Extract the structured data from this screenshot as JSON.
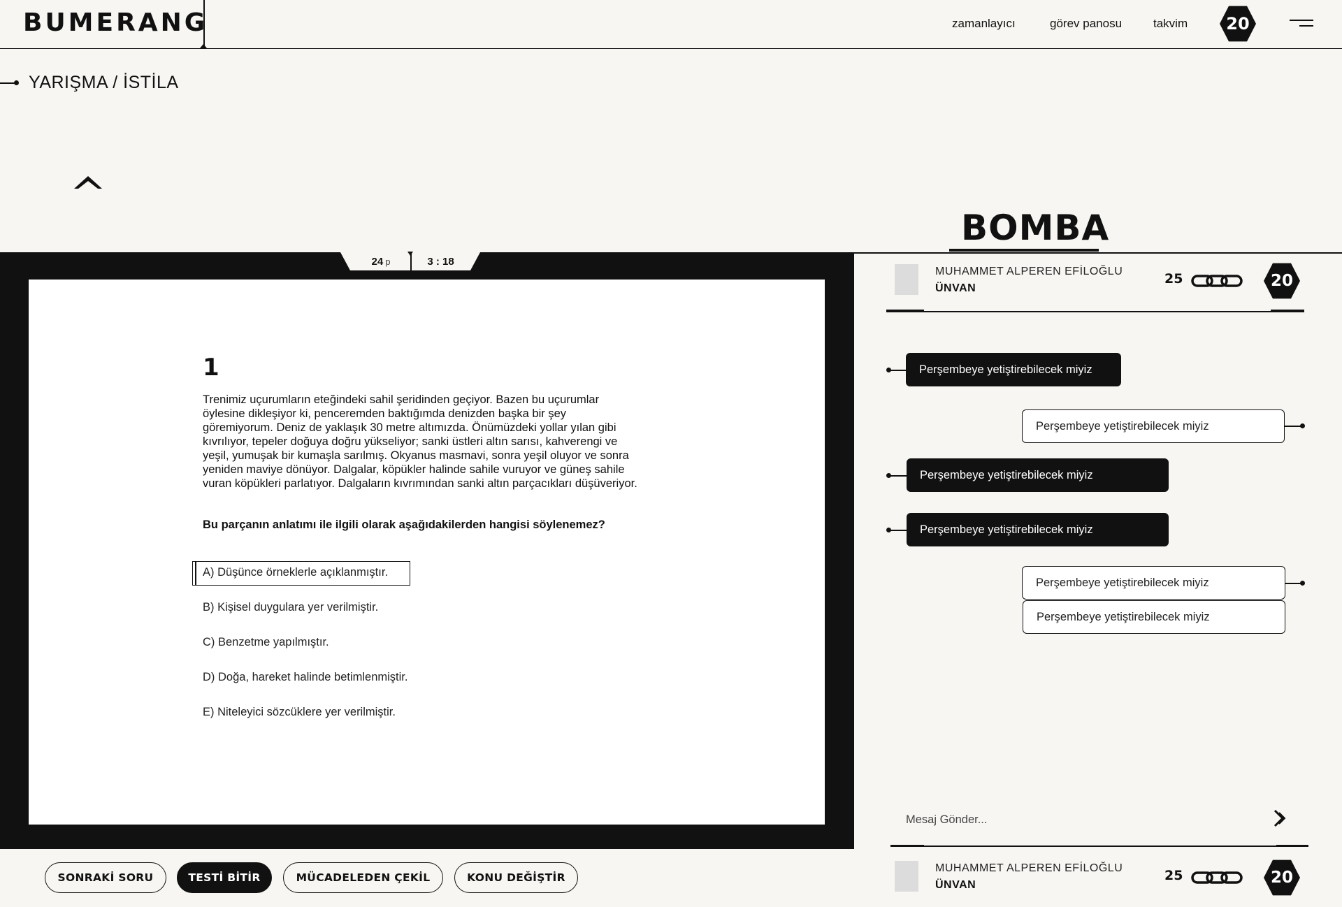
{
  "header": {
    "logo": "BUMERANG",
    "nav": [
      {
        "label": "zamanlayıcı"
      },
      {
        "label": "görev panosu"
      },
      {
        "label": "takvim"
      }
    ],
    "badge": "20"
  },
  "breadcrumb": "YARIŞMA / İSTİLA",
  "mode_title": "BOMBA",
  "stats": {
    "points": "24",
    "points_unit": "p",
    "time": "3 : 18"
  },
  "question": {
    "number": "1",
    "passage": "Trenimiz uçurumların eteğindeki sahil şeridinden geçiyor. Bazen bu uçurumlar öylesine dikleşiyor ki, penceremden baktığımda denizden başka bir şey göremiyorum. Deniz de yaklaşık 30 metre altımızda. Önümüzdeki yollar yılan gibi kıvrılıyor, tepeler doğuya doğru yükseliyor; sanki üstleri altın sarısı, kahverengi ve yeşil, yumuşak bir kumaşla sarılmış. Okyanus masmavi, sonra yeşil oluyor ve sonra yeniden maviye dönüyor. Dalgalar, köpükler halinde sahile vuruyor ve güneş sahile vuran köpükleri parlatıyor. Dalgaların kıvrımından sanki altın parçacıkları düşüveriyor.",
    "prompt": "Bu parçanın anlatımı ile ilgili olarak aşağıdakilerden hangisi söylenemez?",
    "options": [
      "A) Düşünce örneklerle açıklanmıştır.",
      "B) Kişisel duygulara yer verilmiştir.",
      "C) Benzetme yapılmıştır.",
      "D) Doğa, hareket halinde betimlenmiştir.",
      "E) Niteleyici sözcüklere yer verilmiştir."
    ],
    "selected_index": 0
  },
  "buttons": {
    "next": "SONRAKİ SORU",
    "finish": "TESTİ BİTİR",
    "withdraw": "MÜCADELEDEN ÇEKİL",
    "change_topic": "KONU DEĞİŞTİR"
  },
  "opponent": {
    "name": "MUHAMMET ALPEREN EFİLOĞLU",
    "title": "ÜNVAN",
    "count": "25",
    "badge": "20"
  },
  "messages": [
    {
      "text": "Perşembeye yetiştirebilecek miyiz",
      "side": "left"
    },
    {
      "text": "Perşembeye yetiştirebilecek miyiz",
      "side": "right"
    },
    {
      "text": "Perşembeye yetiştirebilecek miyiz",
      "side": "left"
    },
    {
      "text": "Perşembeye yetiştirebilecek miyiz",
      "side": "left"
    },
    {
      "text": "Perşembeye yetiştirebilecek miyiz",
      "side": "right"
    },
    {
      "text": "Perşembeye yetiştirebilecek miyiz",
      "side": "right"
    }
  ],
  "chat_input": {
    "placeholder": "Mesaj Gönder..."
  },
  "me": {
    "name": "MUHAMMET ALPEREN EFİLOĞLU",
    "title": "ÜNVAN",
    "count": "25",
    "badge": "20"
  },
  "colors": {
    "background": "#f7f6f2",
    "ink": "#111111",
    "paper": "#ffffff"
  },
  "icons": [
    "chevron-up-icon",
    "menu-icon",
    "chain-icon",
    "send-icon"
  ]
}
